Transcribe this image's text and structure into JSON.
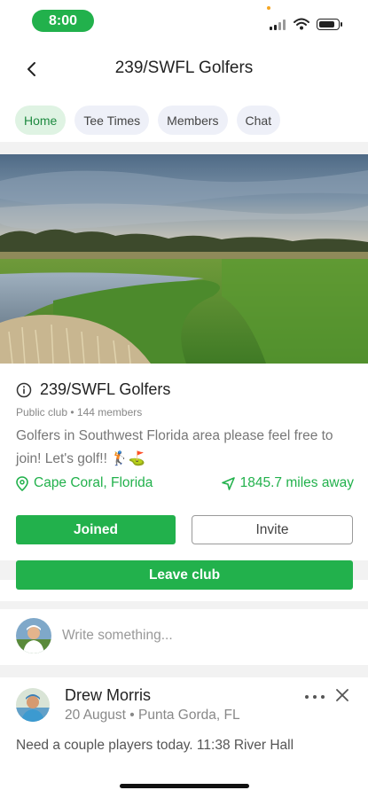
{
  "status_bar": {
    "time": "8:00"
  },
  "header": {
    "title": "239/SWFL Golfers"
  },
  "tabs": [
    {
      "label": "Home",
      "active": true
    },
    {
      "label": "Tee Times",
      "active": false
    },
    {
      "label": "Members",
      "active": false
    },
    {
      "label": "Chat",
      "active": false
    }
  ],
  "club": {
    "name": "239/SWFL Golfers",
    "meta": "Public club • 144 members",
    "description": "Golfers in Southwest Florida area please feel free to join! Let's golf!! 🏌️⛳",
    "location": "Cape Coral, Florida",
    "distance": "1845.7 miles away"
  },
  "actions": {
    "joined_label": "Joined",
    "invite_label": "Invite",
    "leave_label": "Leave club"
  },
  "composer": {
    "placeholder": "Write something..."
  },
  "post": {
    "author": "Drew Morris",
    "subtitle": "20 August • Punta Gorda, FL",
    "body": "Need a couple players today. 11:38 River Hall"
  },
  "colors": {
    "accent": "#22b14c",
    "active_tab_bg": "#dff3e3",
    "tab_bg": "#eef0f8"
  },
  "icons": [
    "back-arrow-icon",
    "info-icon",
    "location-pin-icon",
    "navigation-arrow-icon",
    "more-icon",
    "close-icon",
    "signal-icon",
    "wifi-icon",
    "battery-icon"
  ]
}
